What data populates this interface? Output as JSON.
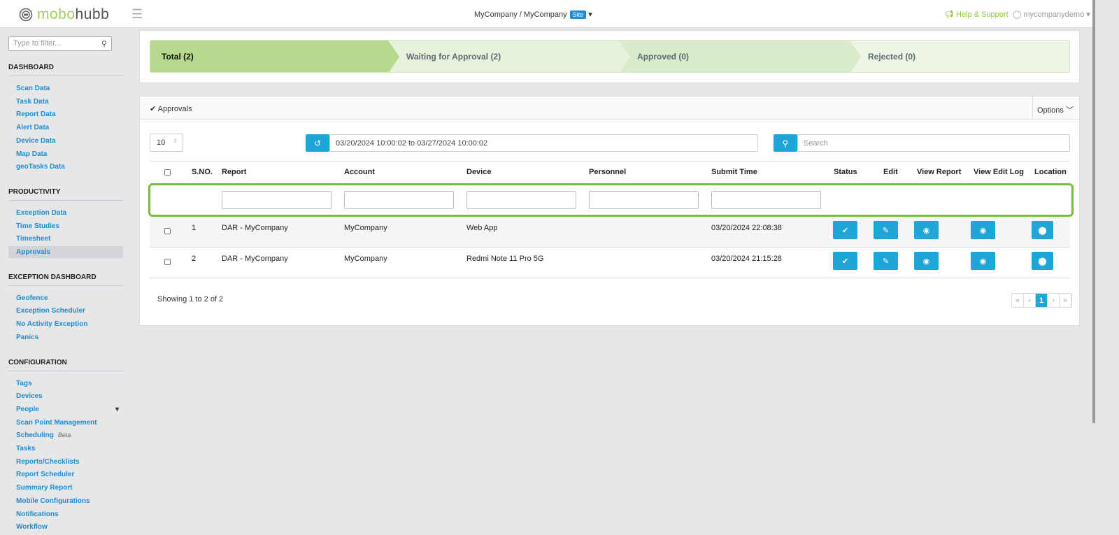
{
  "header": {
    "logo_a": "mobo",
    "logo_b": "hubb",
    "breadcrumb": "MyCompany / MyCompany",
    "site_badge": "Site",
    "help": "Help & Support",
    "user": "mycompanydemo"
  },
  "sidebar": {
    "filter_placeholder": "Type to filter...",
    "sections": [
      {
        "title": "DASHBOARD",
        "items": [
          "Scan Data",
          "Task Data",
          "Report Data",
          "Alert Data",
          "Device Data",
          "Map Data",
          "geoTasks Data"
        ]
      },
      {
        "title": "PRODUCTIVITY",
        "items": [
          "Exception Data",
          "Time Studies",
          "Timesheet",
          "Approvals"
        ]
      },
      {
        "title": "EXCEPTION DASHBOARD",
        "items": [
          "Geofence",
          "Exception Scheduler",
          "No Activity Exception",
          "Panics"
        ]
      },
      {
        "title": "CONFIGURATION",
        "items": [
          "Tags",
          "Devices",
          "People",
          "Scan Point Management",
          "Scheduling",
          "Tasks",
          "Reports/Checklists",
          "Report Scheduler",
          "Summary Report",
          "Mobile Configurations",
          "Notifications",
          "Workflow"
        ]
      }
    ],
    "beta": "Beta",
    "active": "Approvals"
  },
  "steps": [
    "Total (2)",
    "Waiting for Approval (2)",
    "Approved (0)",
    "Rejected (0)"
  ],
  "panel": {
    "title": "Approvals",
    "options": "Options",
    "page_length": "10",
    "date_range": "03/20/2024 10:00:02 to 03/27/2024 10:00:02",
    "search_placeholder": "Search"
  },
  "columns": [
    "S.NO.",
    "Report",
    "Account",
    "Device",
    "Personnel",
    "Submit Time",
    "Status",
    "Edit",
    "View Report",
    "View Edit Log",
    "Location"
  ],
  "rows": [
    {
      "sno": "1",
      "report": "DAR - MyCompany",
      "account": "MyCompany",
      "device": "Web App",
      "personnel": "",
      "time": "03/20/2024 22:08:38"
    },
    {
      "sno": "2",
      "report": "DAR - MyCompany",
      "account": "MyCompany",
      "device": "Redmi Note 11 Pro 5G",
      "personnel": "",
      "time": "03/20/2024 21:15:28"
    }
  ],
  "footer": {
    "info": "Showing 1 to 2 of 2",
    "pages": [
      "«",
      "‹",
      "1",
      "›",
      "»"
    ]
  },
  "colors": {
    "accent": "#1fa5d8",
    "green": "#8cc63f",
    "highlight": "#79bb43"
  }
}
